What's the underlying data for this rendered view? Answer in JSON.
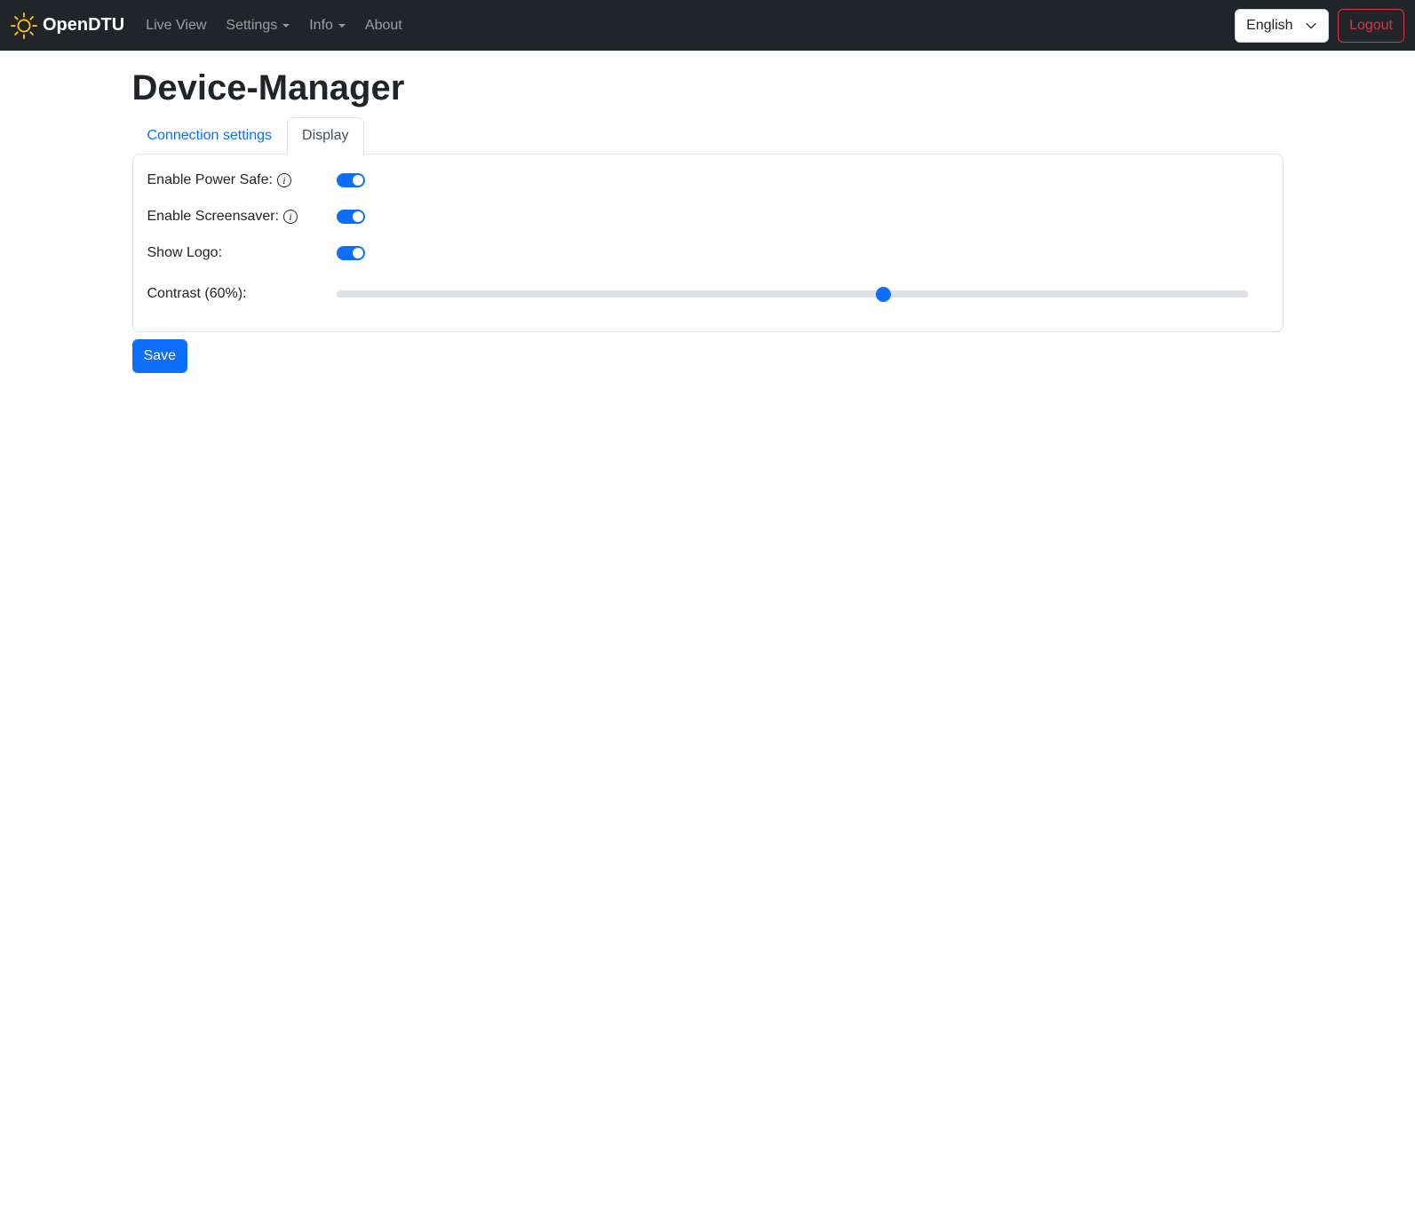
{
  "colors": {
    "primary": "#0d6efd",
    "danger": "#dc3545",
    "brand_yellow": "#ffc107",
    "navbar_bg": "#212529",
    "border": "#dee2e6"
  },
  "navbar": {
    "brand": "OpenDTU",
    "items": [
      {
        "label": "Live View",
        "has_dropdown": false
      },
      {
        "label": "Settings",
        "has_dropdown": true
      },
      {
        "label": "Info",
        "has_dropdown": true
      },
      {
        "label": "About",
        "has_dropdown": false
      }
    ],
    "language_selector": {
      "value": "English"
    },
    "logout_label": "Logout"
  },
  "page": {
    "title": "Device-Manager"
  },
  "tabs": [
    {
      "label": "Connection settings",
      "active": false
    },
    {
      "label": "Display",
      "active": true
    }
  ],
  "form": {
    "fields": [
      {
        "label": "Enable Power Safe:",
        "type": "toggle",
        "value": true,
        "has_info": true
      },
      {
        "label": "Enable Screensaver:",
        "type": "toggle",
        "value": true,
        "has_info": true
      },
      {
        "label": "Show Logo:",
        "type": "toggle",
        "value": true,
        "has_info": false
      },
      {
        "label": "Contrast (60%):",
        "type": "range",
        "value": 60,
        "min": 0,
        "max": 100,
        "has_info": false
      }
    ],
    "save_label": "Save"
  }
}
